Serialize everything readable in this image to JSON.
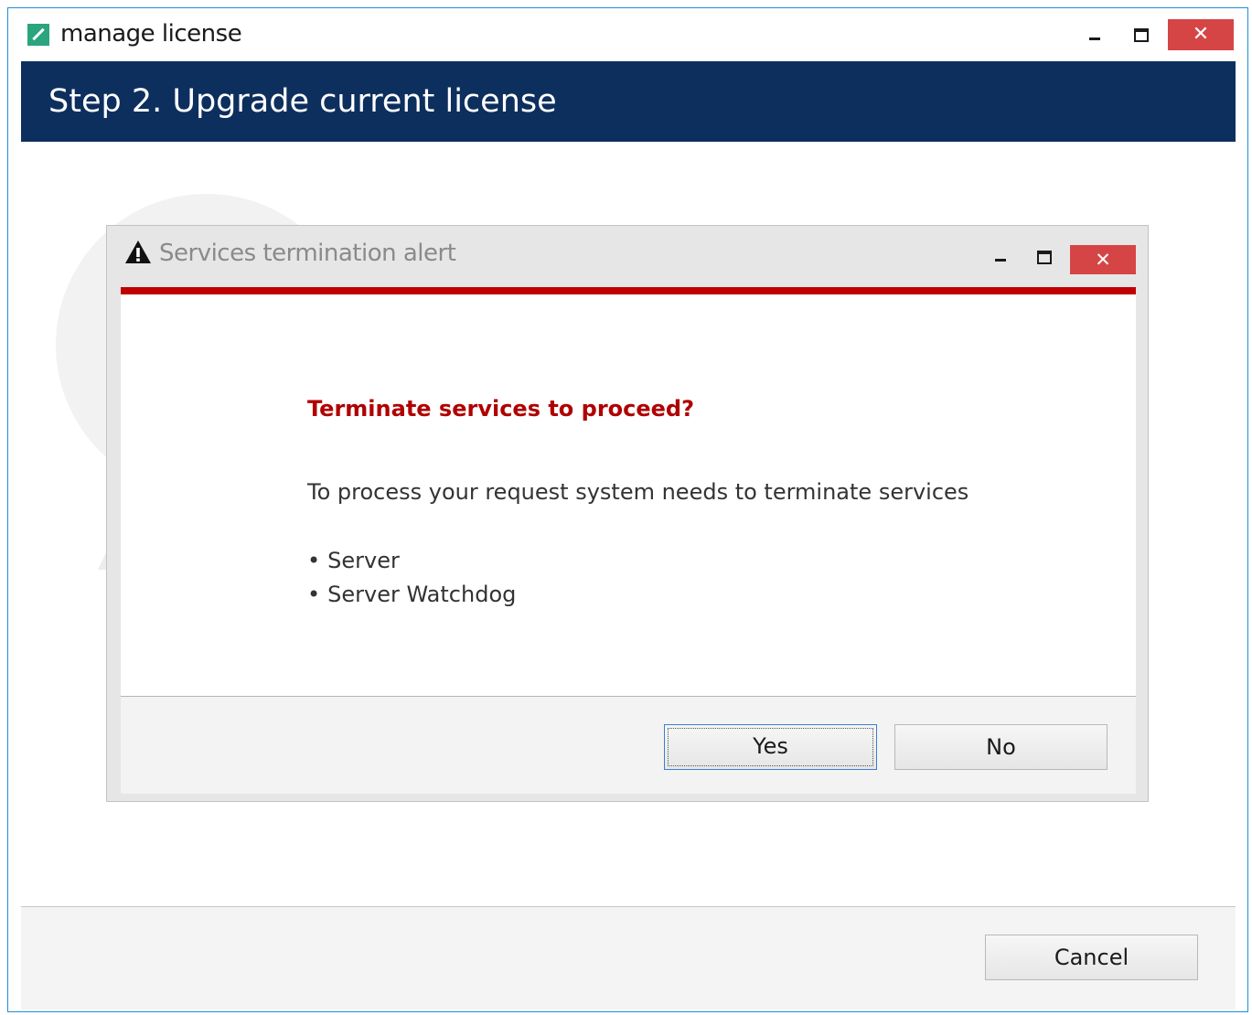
{
  "window": {
    "title": "manage license",
    "close_glyph": "✕"
  },
  "header": {
    "step_title": "Step 2. Upgrade current license"
  },
  "footer": {
    "cancel_label": "Cancel"
  },
  "dialog": {
    "title": "Services termination alert",
    "close_glyph": "✕",
    "heading": "Terminate services to proceed?",
    "message": "To process your request system needs to terminate services",
    "services": [
      "Server",
      "Server Watchdog"
    ],
    "yes_label": "Yes",
    "no_label": "No"
  },
  "colors": {
    "header_banner": "#0d2f5e",
    "close_button": "#d64545",
    "alert_accent": "#c00000",
    "alert_heading": "#b00000",
    "window_border": "#1e8fd6"
  },
  "icons": {
    "app": "license-app-icon",
    "dialog": "warning-icon",
    "watermark": "warning-watermark-icon"
  }
}
